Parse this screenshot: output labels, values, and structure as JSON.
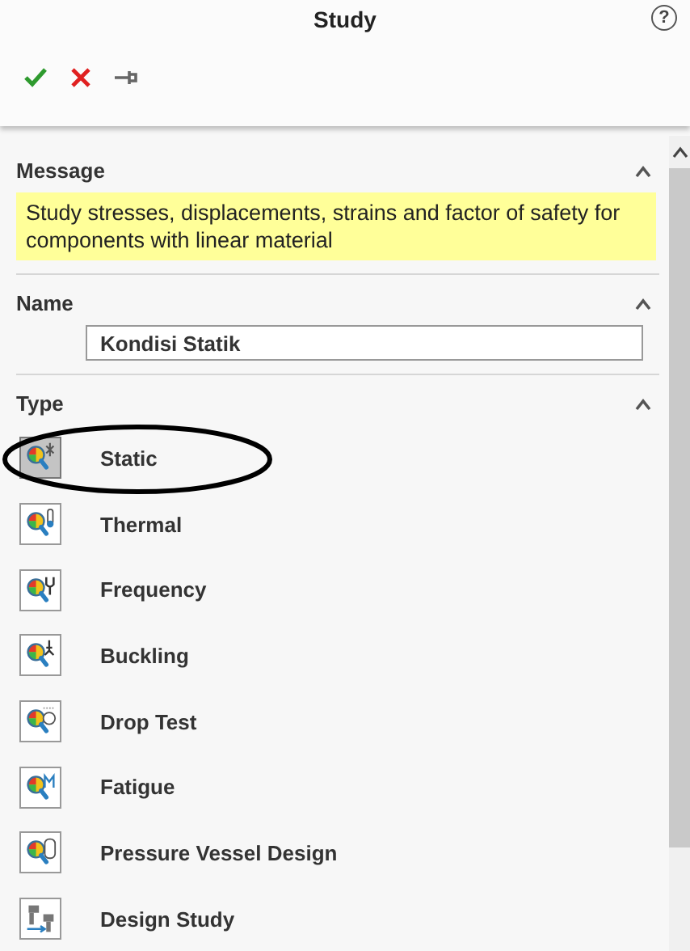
{
  "window": {
    "title": "Study",
    "help": "?"
  },
  "toolbar": [
    {
      "kind": "ok"
    },
    {
      "kind": "cancel"
    },
    {
      "kind": "pin"
    }
  ],
  "message": {
    "heading": "Message",
    "text": "Study stresses, displacements, strains and factor of safety for components with linear material",
    "expanded": true
  },
  "name": {
    "heading": "Name",
    "value": "Kondisi Statik",
    "expanded": true
  },
  "type": {
    "heading": "Type",
    "expanded": true,
    "items": [
      {
        "label": "Static",
        "selected": true,
        "circled": true
      },
      {
        "label": "Thermal",
        "selected": false,
        "circled": false
      },
      {
        "label": "Frequency",
        "selected": false,
        "circled": false
      },
      {
        "label": "Buckling",
        "selected": false,
        "circled": false
      },
      {
        "label": "Drop Test",
        "selected": false,
        "circled": false
      },
      {
        "label": "Fatigue",
        "selected": false,
        "circled": false
      },
      {
        "label": "Pressure Vessel Design",
        "selected": false,
        "circled": false
      },
      {
        "label": "Design Study",
        "selected": false,
        "circled": false
      }
    ]
  }
}
